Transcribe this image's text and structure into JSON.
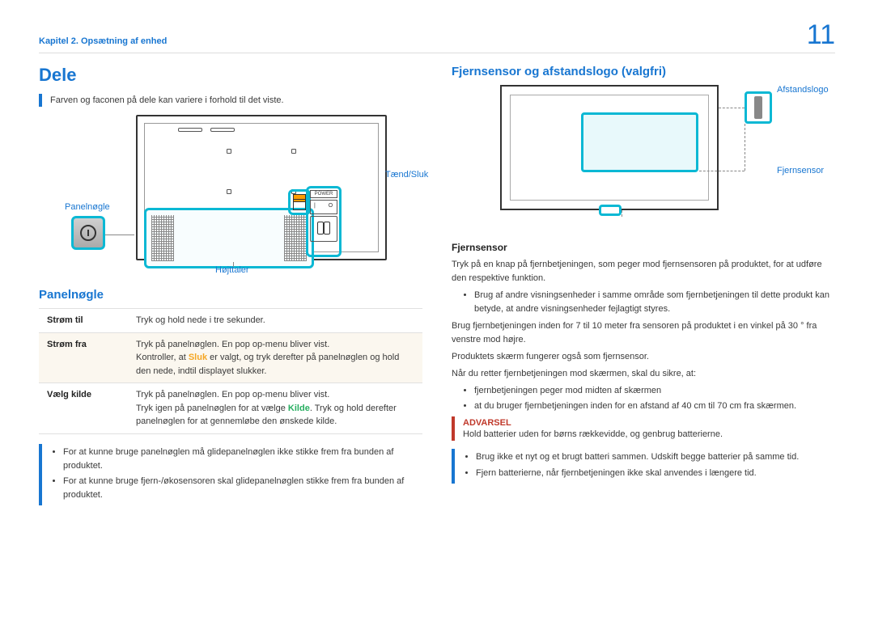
{
  "page": {
    "chapter": "Kapitel 2. Opsætning af enhed",
    "number": "11"
  },
  "left": {
    "title": "Dele",
    "intro": "Farven og faconen på dele kan variere i forhold til det viste.",
    "diagram_labels": {
      "panel_key": "Panelnøgle",
      "speaker": "Højttaler",
      "power": "Tænd/Sluk"
    },
    "power_button_text": "POWER",
    "section_panel_key": "Panelnøgle",
    "table": {
      "r1k": "Strøm til",
      "r1v": "Tryk og hold nede i tre sekunder.",
      "r2k": "Strøm fra",
      "r2v_a": "Tryk på panelnøglen. En pop op-menu bliver vist.",
      "r2v_b1": "Kontroller, at ",
      "r2v_b_kw": "Sluk",
      "r2v_b2": " er valgt, og tryk derefter på panelnøglen og hold den nede, indtil displayet slukker.",
      "r3k": "Vælg kilde",
      "r3v_a": "Tryk på panelnøglen. En pop op-menu bliver vist.",
      "r3v_b1": "Tryk igen på panelnøglen for at vælge ",
      "r3v_b_kw": "Kilde",
      "r3v_b2": ". Tryk og hold derefter panelnøglen for at gennemløbe den ønskede kilde."
    },
    "notes": {
      "n1": "For at kunne bruge panelnøglen må glidepanelnøglen ikke stikke frem fra bunden af produktet.",
      "n2": "For at kunne bruge fjern-/økosensoren skal glidepanelnøglen stikke frem fra bunden af produktet."
    }
  },
  "right": {
    "title": "Fjernsensor og afstandslogo (valgfri)",
    "diagram_labels": {
      "logo": "Afstandslogo",
      "sensor": "Fjernsensor"
    },
    "h_sensor": "Fjernsensor",
    "p1": "Tryk på en knap på fjernbetjeningen, som peger mod fjernsensoren på produktet, for at udføre den respektive funktion.",
    "b1": "Brug af andre visningsenheder i samme område som fjernbetjeningen til dette produkt kan betyde, at andre visningsenheder fejlagtigt styres.",
    "p2": "Brug fjernbetjeningen inden for 7 til 10 meter fra sensoren på produktet i en vinkel på 30 ° fra venstre mod højre.",
    "p3": "Produktets skærm fungerer også som fjernsensor.",
    "p4": "Når du retter fjernbetjeningen mod skærmen, skal du sikre, at:",
    "b2": "fjernbetjeningen peger mod midten af skærmen",
    "b3": "at du bruger fjernbetjeningen inden for en afstand af 40 cm til 70 cm fra skærmen.",
    "warn_title": "ADVARSEL",
    "warn_text": "Hold batterier uden for børns rækkevidde, og genbrug batterierne.",
    "b4": "Brug ikke et nyt og et brugt batteri sammen. Udskift begge batterier på samme tid.",
    "b5": "Fjern batterierne, når fjernbetjeningen ikke skal anvendes i længere tid."
  }
}
